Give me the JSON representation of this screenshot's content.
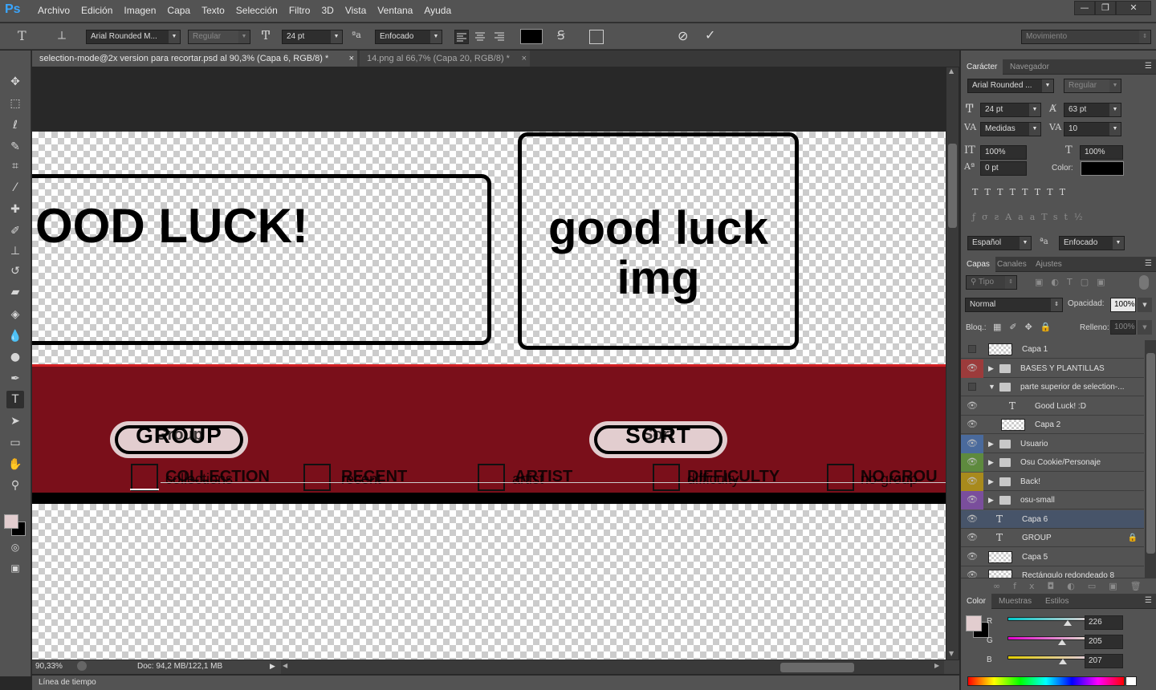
{
  "app": {
    "logo": "Ps"
  },
  "menu": [
    "Archivo",
    "Edición",
    "Imagen",
    "Capa",
    "Texto",
    "Selección",
    "Filtro",
    "3D",
    "Vista",
    "Ventana",
    "Ayuda"
  ],
  "window_controls": {
    "minimize": "—",
    "restore": "❐",
    "close": "✕"
  },
  "options": {
    "font_family": "Arial Rounded M...",
    "font_style": "Regular",
    "font_size": "24 pt",
    "antialias": "Enfocado",
    "text_color": "#000000",
    "workspace": "Movimiento"
  },
  "tabs": [
    {
      "label": "selection-mode@2x version para recortar.psd  al 90,3% (Capa 6, RGB/8) *",
      "close": "×"
    },
    {
      "label": "14.png al 66,7% (Capa 20, RGB/8) *",
      "close": "×"
    }
  ],
  "canvas": {
    "good_luck_caps": "OOD LUCK!",
    "good_luck_img_line1": "good luck",
    "good_luck_img_line2": "img",
    "group_label": "GROUP",
    "group_ghost": "Group",
    "sort_label": "SORT",
    "sort_ghost": "Sort",
    "band_color": "#7a0f1a",
    "checkboxes": [
      {
        "label": "COLLECTION",
        "ghost": "collections"
      },
      {
        "label": "RECENT",
        "ghost": "recent"
      },
      {
        "label": "ARTIST",
        "ghost": "artist"
      },
      {
        "label": "DIFFICULTY",
        "ghost": "difficulty"
      },
      {
        "label": "NO GROU",
        "ghost": "no group"
      }
    ]
  },
  "status": {
    "zoom": "90,33%",
    "doc": "Doc: 94,2 MB/122,1 MB"
  },
  "timeline": {
    "label": "Línea de tiempo"
  },
  "character_panel": {
    "tabs": [
      "Carácter",
      "Navegador"
    ],
    "font_family": "Arial Rounded ...",
    "font_style": "Regular",
    "size": "24 pt",
    "leading": "63 pt",
    "kerning": "Medidas",
    "tracking": "10",
    "vscale": "100%",
    "hscale": "100%",
    "baseline": "0 pt",
    "color_label": "Color:",
    "language": "Español",
    "antialias": "Enfocado"
  },
  "layers_panel": {
    "tabs": [
      "Capas",
      "Canales",
      "Ajustes"
    ],
    "filter": "Tipo",
    "blend_mode": "Normal",
    "opacity_label": "Opacidad:",
    "opacity": "100%",
    "lock_label": "Bloq.:",
    "fill_label": "Relleno:",
    "fill": "100%",
    "layers": [
      {
        "name": "Capa 1",
        "kind": "pixel",
        "indent": 0,
        "eye": false,
        "color": ""
      },
      {
        "name": "BASES Y PLANTILLAS",
        "kind": "folder",
        "indent": 0,
        "eye": true,
        "color": "#9c3b3b",
        "open": false
      },
      {
        "name": "parte superior de selection-...",
        "kind": "folder",
        "indent": 0,
        "eye": false,
        "color": "",
        "open": true
      },
      {
        "name": "Good Luck!       :D",
        "kind": "text",
        "indent": 1,
        "eye": true,
        "color": ""
      },
      {
        "name": "Capa 2",
        "kind": "pixel",
        "indent": 1,
        "eye": true,
        "color": ""
      },
      {
        "name": "Usuario",
        "kind": "folder",
        "indent": 0,
        "eye": true,
        "color": "#4a6a9c",
        "open": false
      },
      {
        "name": "Osu Cookie/Personaje",
        "kind": "folder",
        "indent": 0,
        "eye": true,
        "color": "#5e8a3e",
        "open": false
      },
      {
        "name": "Back!",
        "kind": "folder",
        "indent": 0,
        "eye": true,
        "color": "#a88a1c",
        "open": false
      },
      {
        "name": "osu-small",
        "kind": "folder",
        "indent": 0,
        "eye": true,
        "color": "#7a4e9c",
        "open": false
      },
      {
        "name": "Capa 6",
        "kind": "text",
        "indent": 0,
        "eye": true,
        "color": "",
        "selected": true
      },
      {
        "name": "GROUP",
        "kind": "text",
        "indent": 0,
        "eye": true,
        "color": "",
        "locked": true
      },
      {
        "name": "Capa 5",
        "kind": "pixel",
        "indent": 0,
        "eye": true,
        "color": ""
      },
      {
        "name": "Rectángulo redondeado 8",
        "kind": "pixel",
        "indent": 0,
        "eye": true,
        "color": ""
      }
    ]
  },
  "color_panel": {
    "tabs": [
      "Color",
      "Muestras",
      "Estilos"
    ],
    "r_label": "R",
    "g_label": "G",
    "b_label": "B",
    "r": "226",
    "g": "205",
    "b": "207",
    "fg_color": "#e2cdcf",
    "bg_color": "#000000"
  },
  "tools": [
    "move-icon",
    "marquee-icon",
    "lasso-icon",
    "quick-select-icon",
    "crop-icon",
    "eyedropper-icon",
    "healing-icon",
    "brush-icon",
    "stamp-icon",
    "history-brush-icon",
    "eraser-icon",
    "gradient-icon",
    "blur-icon",
    "dodge-icon",
    "pen-icon",
    "type-icon",
    "path-select-icon",
    "shape-icon",
    "hand-icon",
    "zoom-icon"
  ]
}
